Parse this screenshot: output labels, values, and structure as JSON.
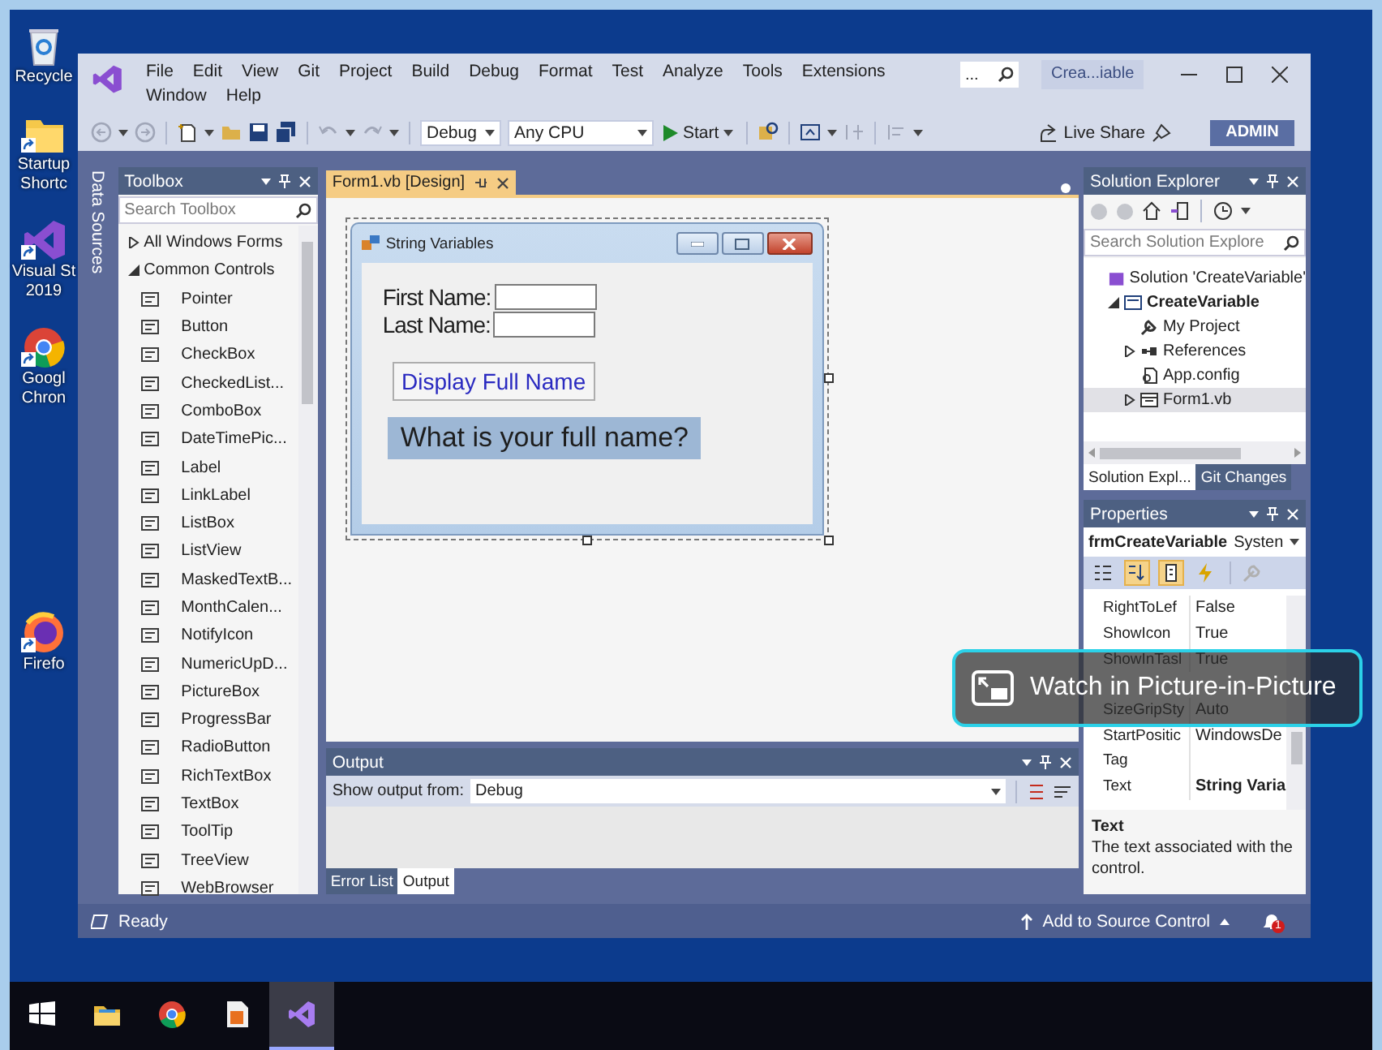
{
  "desktop": {
    "icons": [
      {
        "kind": "recycle-bin",
        "label": "Recycle",
        "shortcut": false
      },
      {
        "kind": "folder",
        "label": "Startup Shortc",
        "shortcut": true
      },
      {
        "kind": "visual-studio",
        "label": "Visual St 2019",
        "shortcut": true
      },
      {
        "kind": "chrome",
        "label": "Googl Chron",
        "shortcut": true
      },
      {
        "kind": "firefox",
        "label": "Firefo",
        "shortcut": true
      }
    ]
  },
  "ide": {
    "menu": [
      "File",
      "Edit",
      "View",
      "Git",
      "Project",
      "Build",
      "Debug",
      "Format",
      "Test",
      "Analyze",
      "Tools",
      "Extensions",
      "Window",
      "Help"
    ],
    "search": {
      "placeholder": "..."
    },
    "solution_name": "Crea...iable",
    "toolbar": {
      "configuration": "Debug",
      "platform": "Any CPU",
      "start": "Start",
      "live_share": "Live Share",
      "account": "ADMIN"
    },
    "data_sources": "Data Sources",
    "toolbox": {
      "title": "Toolbox",
      "search": {
        "placeholder": "Search Toolbox"
      },
      "groups": [
        {
          "label": "All Windows Forms",
          "expanded": false
        },
        {
          "label": "Common Controls",
          "expanded": true,
          "children": [
            {
              "label": "Pointer"
            },
            {
              "label": "Button"
            },
            {
              "label": "CheckBox"
            },
            {
              "label": "CheckedList..."
            },
            {
              "label": "ComboBox"
            },
            {
              "label": "DateTimePic..."
            },
            {
              "label": "Label"
            },
            {
              "label": "LinkLabel"
            },
            {
              "label": "ListBox"
            },
            {
              "label": "ListView"
            },
            {
              "label": "MaskedTextB..."
            },
            {
              "label": "MonthCalen..."
            },
            {
              "label": "NotifyIcon"
            },
            {
              "label": "NumericUpD..."
            },
            {
              "label": "PictureBox"
            },
            {
              "label": "ProgressBar"
            },
            {
              "label": "RadioButton"
            },
            {
              "label": "RichTextBox"
            },
            {
              "label": "TextBox"
            },
            {
              "label": "ToolTip"
            },
            {
              "label": "TreeView"
            },
            {
              "label": "WebBrowser"
            }
          ]
        }
      ]
    },
    "designer": {
      "tab": "Form1.vb [Design]",
      "form": {
        "title": "String Variables",
        "fields": [
          {
            "label": "First Name:"
          },
          {
            "label": "Last Name:"
          }
        ],
        "button": "Display Full Name",
        "message": "What is your full name?"
      }
    },
    "output": {
      "title": "Output",
      "source_label": "Show output from:",
      "source": "Debug",
      "tabs": [
        {
          "label": "Error List",
          "selected": false
        },
        {
          "label": "Output",
          "selected": true
        }
      ]
    },
    "solution_explorer": {
      "title": "Solution Explorer",
      "search": {
        "placeholder": "Search Solution Explore"
      },
      "tree": [
        {
          "kind": "solution",
          "label": "Solution 'CreateVariable'",
          "selected": false,
          "children": [
            {
              "kind": "project",
              "label": "CreateVariable",
              "expanded": true,
              "selected": false,
              "children": [
                {
                  "kind": "my-project",
                  "label": "My Project",
                  "selected": false
                },
                {
                  "kind": "references",
                  "label": "References",
                  "expanded": false,
                  "selected": false
                },
                {
                  "kind": "config",
                  "label": "App.config",
                  "selected": false
                },
                {
                  "kind": "form",
                  "label": "Form1.vb",
                  "expanded": false,
                  "selected": true
                }
              ]
            }
          ]
        }
      ],
      "tabs": [
        {
          "label": "Solution Expl...",
          "selected": true
        },
        {
          "label": "Git Changes",
          "selected": false
        }
      ]
    },
    "properties": {
      "title": "Properties",
      "object": "frmCreateVariable",
      "object_type": "Systen",
      "tools": [
        {
          "kind": "categorized",
          "selected": false
        },
        {
          "kind": "alphabetical",
          "selected": true
        },
        {
          "kind": "property-pages",
          "selected": true
        },
        {
          "kind": "events",
          "selected": false
        }
      ],
      "rows": [
        {
          "kind": "property",
          "name": "RightToLef",
          "value": "False",
          "modified": false
        },
        {
          "kind": "property",
          "name": "ShowIcon",
          "value": "True",
          "modified": false
        },
        {
          "kind": "property",
          "name": "ShowInTasl",
          "value": "True",
          "modified": false
        },
        {
          "kind": "covered"
        },
        {
          "kind": "property",
          "name": "SizeGripSty",
          "value": "Auto",
          "modified": false
        },
        {
          "kind": "property",
          "name": "StartPositic",
          "value": "WindowsDe",
          "modified": false
        },
        {
          "kind": "property",
          "name": "Tag"
        },
        {
          "kind": "property",
          "name": "Text",
          "value": "String Varia",
          "modified": true
        }
      ],
      "description": {
        "title": "Text",
        "text": "The text associated with the control."
      }
    },
    "status_bar": {
      "text": "Ready",
      "source_control": "Add to Source Control",
      "notifications": "1"
    }
  },
  "pip_overlay": {
    "label": "Watch in Picture-in-Picture"
  },
  "taskbar": {
    "items": [
      {
        "kind": "start",
        "selected": false
      },
      {
        "kind": "file-explorer",
        "selected": false
      },
      {
        "kind": "chrome",
        "selected": false
      },
      {
        "kind": "document-app",
        "selected": false
      },
      {
        "kind": "visual-studio",
        "selected": true
      }
    ]
  }
}
